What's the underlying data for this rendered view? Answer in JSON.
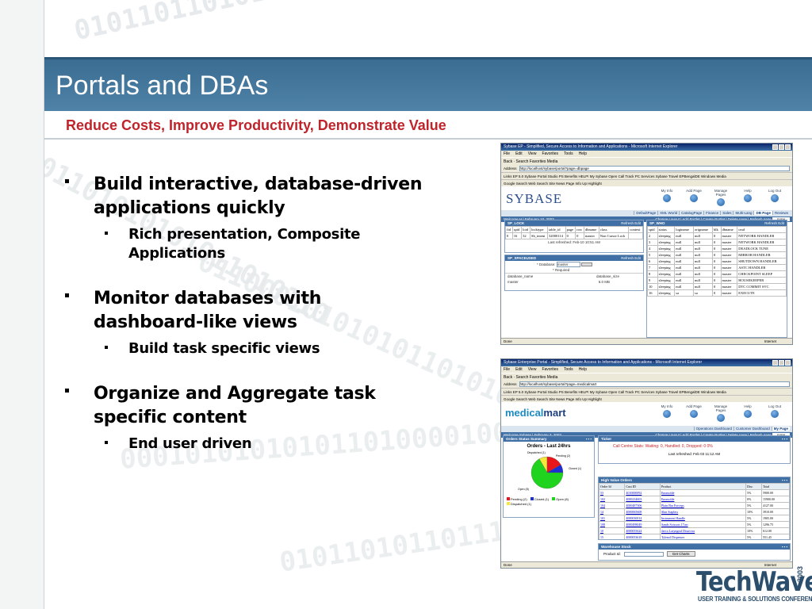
{
  "slide": {
    "title": "Portals and DBAs",
    "subtitle": "Reduce Costs, Improve Productivity, Demonstrate Value",
    "bullets": [
      {
        "text": "Build interactive, database-driven applications quickly",
        "sub": [
          "Rich presentation, Composite Applications"
        ]
      },
      {
        "text": "Monitor databases with dashboard-like views",
        "sub": [
          "Build task specific views"
        ]
      },
      {
        "text": "Organize and Aggregate task specific content",
        "sub": [
          "End user driven"
        ]
      }
    ],
    "logo": {
      "main": "TechWave",
      "year": "2003",
      "sub": "USER TRAINING & SOLUTIONS CONFERENCE"
    }
  },
  "colors": {
    "title_band": "#3f739a",
    "subtitle": "#c0242b",
    "panel_head": "#3f6fa5"
  },
  "shot1": {
    "window_title": "Sybase EP - Simplified, Secure Access to Information and Applications - Microsoft Internet Explorer",
    "menu": [
      "File",
      "Edit",
      "View",
      "Favorites",
      "Tools",
      "Help"
    ],
    "toolbar": "Back  ·  Search  Favorites  Media",
    "address_label": "Address",
    "address_value": "http://localhost/sybase/portal?page=dbpage",
    "links": "Links  EP 5.0  Sybase Portal Studio  PS Benefits  HELP!  My Sybase  Open Call Track  PC Services  Sybase Travel  EPBengalDE  Windows Media",
    "google": "Google  Search Web  Search Site  News  Page Info  Up  Highlight",
    "brand": "SYBASE",
    "nav": [
      "My Info",
      "Add Page",
      "Manage Pages",
      "Help",
      "Log Out"
    ],
    "tabs": [
      "DefaultPage",
      "XML World",
      "CatalogPage",
      "Finance",
      "Sales",
      "Multi-Lang",
      "DB Page",
      "Reviews"
    ],
    "welcome": "Welcome H | February 10, 2003",
    "actions": "Change Layout | Add Portlet | Create Portlet | Delete page | Refresh page",
    "action_select": "none",
    "lock_title": "SP_LOCK",
    "lock_head": [
      "fid",
      "spid",
      "loid",
      "locktype",
      "table_id",
      "page",
      "row",
      "dbname",
      "class",
      "context"
    ],
    "lock_row": [
      "0",
      "16",
      "32",
      "Sh_intent",
      "32000114",
      "0",
      "0",
      "master",
      "Non Cursor Lock",
      ""
    ],
    "lock_refreshed": "Last refreshed: Feb-10 10:51 AM",
    "spaceused_title": "SP_SPACEUSED",
    "db_label": "* Database:",
    "db_value": "master",
    "required": "* Required",
    "space_head": [
      "database_name",
      "database_size"
    ],
    "space_row": [
      "master",
      "6.0 MB"
    ],
    "space_refreshed": "Last refreshed: Feb-10 10:51 AM",
    "who_title": "SP_WHO",
    "panel_controls": "Refresh  Edit",
    "who_head": [
      "spid",
      "status",
      "loginame",
      "origname",
      "hostname",
      "blk",
      "spid",
      "dbname",
      "cmd"
    ],
    "who_rows": [
      [
        "2",
        "sleeping",
        "null",
        "null",
        "0",
        "master",
        "NETWORK HANDLER"
      ],
      [
        "3",
        "sleeping",
        "null",
        "null",
        "0",
        "master",
        "NETWORK HANDLER"
      ],
      [
        "4",
        "sleeping",
        "null",
        "null",
        "0",
        "master",
        "DEADLOCK TUNE"
      ],
      [
        "5",
        "sleeping",
        "null",
        "null",
        "0",
        "master",
        "MIRROR HANDLER"
      ],
      [
        "6",
        "sleeping",
        "null",
        "null",
        "0",
        "master",
        "SHUTDOWN HANDLER"
      ],
      [
        "7",
        "sleeping",
        "null",
        "null",
        "0",
        "master",
        "ASTC HANDLER"
      ],
      [
        "8",
        "sleeping",
        "null",
        "null",
        "0",
        "master",
        "CHECKPOINT SLEEP"
      ],
      [
        "9",
        "sleeping",
        "null",
        "null",
        "0",
        "master",
        "HOUSEKEEPER"
      ],
      [
        "10",
        "sleeping",
        "null",
        "null",
        "0",
        "master",
        "DTC COMMIT SVC"
      ],
      [
        "16",
        "sleeping",
        "sa",
        "sa",
        "0",
        "master",
        "EXECUTE"
      ]
    ],
    "status_left": "Done",
    "status_right": "Internet"
  },
  "shot2": {
    "window_title": "Sybase Enterprise Portal - Simplified, Secure Access to Information and Applications - Microsoft Internet Explorer",
    "menu": [
      "File",
      "Edit",
      "View",
      "Favorites",
      "Tools",
      "Help"
    ],
    "toolbar": "Back  ·  Search  Favorites  Media",
    "address_label": "Address",
    "address_value": "http://localhost/sybase/portal?page=medicalmart",
    "links": "Links  EP 5.0  Sybase Portal Studio  PS Benefits  HELP!  My Sybase  Open Call Track  PC Services  Sybase Travel  EPBengalDE  Windows Media",
    "google": "Google  Search Web  Search Site  News  Page Info  Up  Highlight",
    "brand_a": "medical",
    "brand_b": "mart",
    "nav": [
      "My Info",
      "Add Page",
      "Manage Pages",
      "Help",
      "Log Out"
    ],
    "tabs": [
      "Operations Dashboard",
      "Customer Dashboard",
      "My Page"
    ],
    "welcome": "Welcome Sybase | February 3, 2003",
    "actions": "Change Layout | Add Portlet | Create Portlet | Delete page | Refresh page",
    "action_select": "none",
    "orders_title": "Orders Status Summary",
    "chart_title": "Orders - Last 24hrs",
    "legend": [
      "Pending (2)",
      "Closed (1)",
      "Open (8)",
      "Dispatched (1)"
    ],
    "slice_labels": [
      "Dispatched (1)",
      "Pending (2)",
      "Closed (1)",
      "Open (8)"
    ],
    "ticker_title": "Ticker",
    "ticker_text": "Call Centre Stats: Waiting: 0, Handled: 0, Dropped: 0 0%",
    "ticker_refreshed": "Last refreshed: Feb 03 11:12 AM",
    "hv_title": "High Value Orders",
    "hv_head": [
      "Order Id",
      "Cust ID",
      "Product",
      "Disc",
      "Total"
    ],
    "hv_rows": [
      [
        "53",
        "4010000092",
        "Enomolde",
        "5%",
        "5900.00"
      ],
      [
        "102",
        "4000234603",
        "Enomolde",
        "0%",
        "15900.00"
      ],
      [
        "104",
        "4000487306",
        "Plain Bar Forceps",
        "5%",
        "4127.00"
      ],
      [
        "14",
        "4000065608",
        "Skin Staplers",
        "10%",
        "3910.00"
      ],
      [
        "101",
        "4000030014",
        "Instrument Handle",
        "5%",
        "1905.00"
      ],
      [
        "108",
        "4000498049",
        "Sands Scissors 17cm",
        "5%",
        "1296.75"
      ],
      [
        "10",
        "4000055624",
        "Jaeco Laryngeal Dissector",
        "10%",
        "612.00"
      ],
      [
        "15",
        "4000053618",
        "Tylenol Dispenser",
        "5%",
        "551.45"
      ],
      [
        "109",
        "4000065017",
        "Lamp",
        "5%",
        "323.00"
      ]
    ],
    "wh_title": "Warehouse Stock",
    "product_label": "Product Id:",
    "get_charts": "Get Charts",
    "status_left": "Done",
    "status_right": "Internet"
  },
  "chart_data": {
    "type": "pie",
    "title": "Orders - Last 24hrs",
    "categories": [
      "Pending",
      "Closed",
      "Open",
      "Dispatched"
    ],
    "values": [
      2,
      1,
      8,
      1
    ],
    "colors": [
      "#e8171c",
      "#1c2fd4",
      "#1fd31f",
      "#f5e83a"
    ],
    "legend_position": "bottom"
  }
}
